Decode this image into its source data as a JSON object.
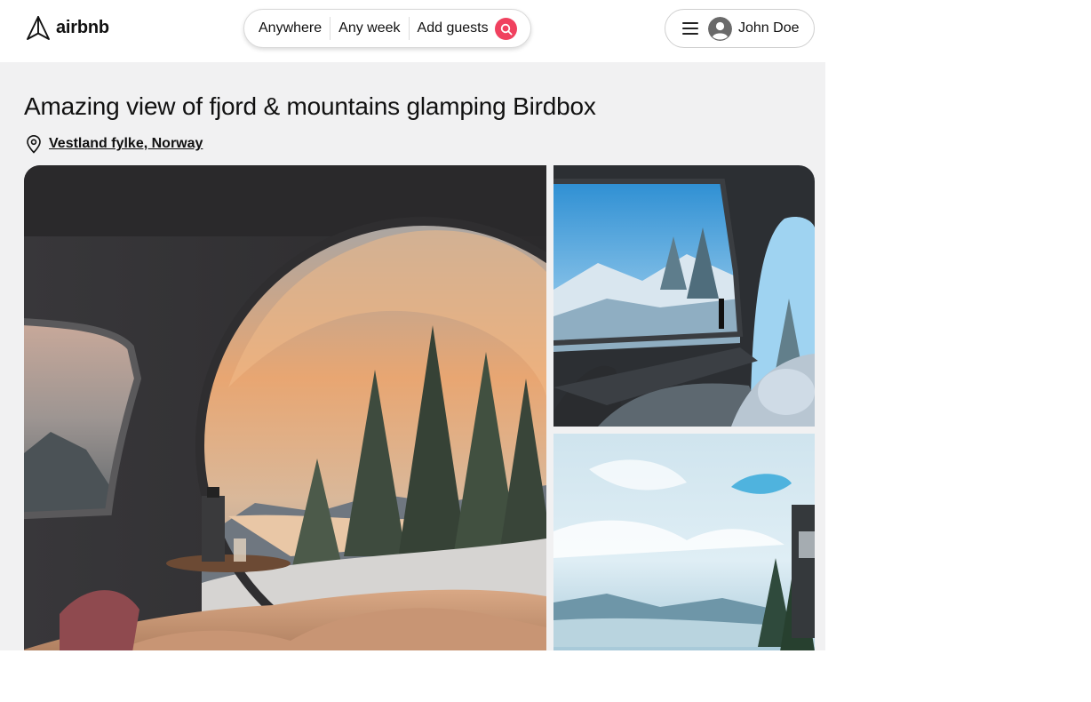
{
  "header": {
    "logo": {
      "icon": "airbnb-logo-icon",
      "text": "airbnb"
    },
    "search": {
      "where": "Anywhere",
      "when": "Any week",
      "guests": "Add guests",
      "button_icon": "search-icon",
      "button_color": "#f0415f"
    },
    "user_menu": {
      "menu_icon": "hamburger-icon",
      "avatar_icon": "user-avatar-icon",
      "name": "John Doe"
    }
  },
  "listing": {
    "title": "Amazing view of fjord & mountains glamping Birdbox",
    "location_icon": "map-pin-icon",
    "location": "Vestland fylke, Norway",
    "photos": [
      {
        "name": "photo-main",
        "subject": "interior-round-window-sunset-fjord"
      },
      {
        "name": "photo-top-right",
        "subject": "interior-window-snowy-valley"
      },
      {
        "name": "photo-bottom-right",
        "subject": "exterior-cloudy-sky-fjord"
      }
    ]
  },
  "colors": {
    "accent": "#f0415f",
    "page_background": "#f1f1f2",
    "text": "#111111"
  }
}
